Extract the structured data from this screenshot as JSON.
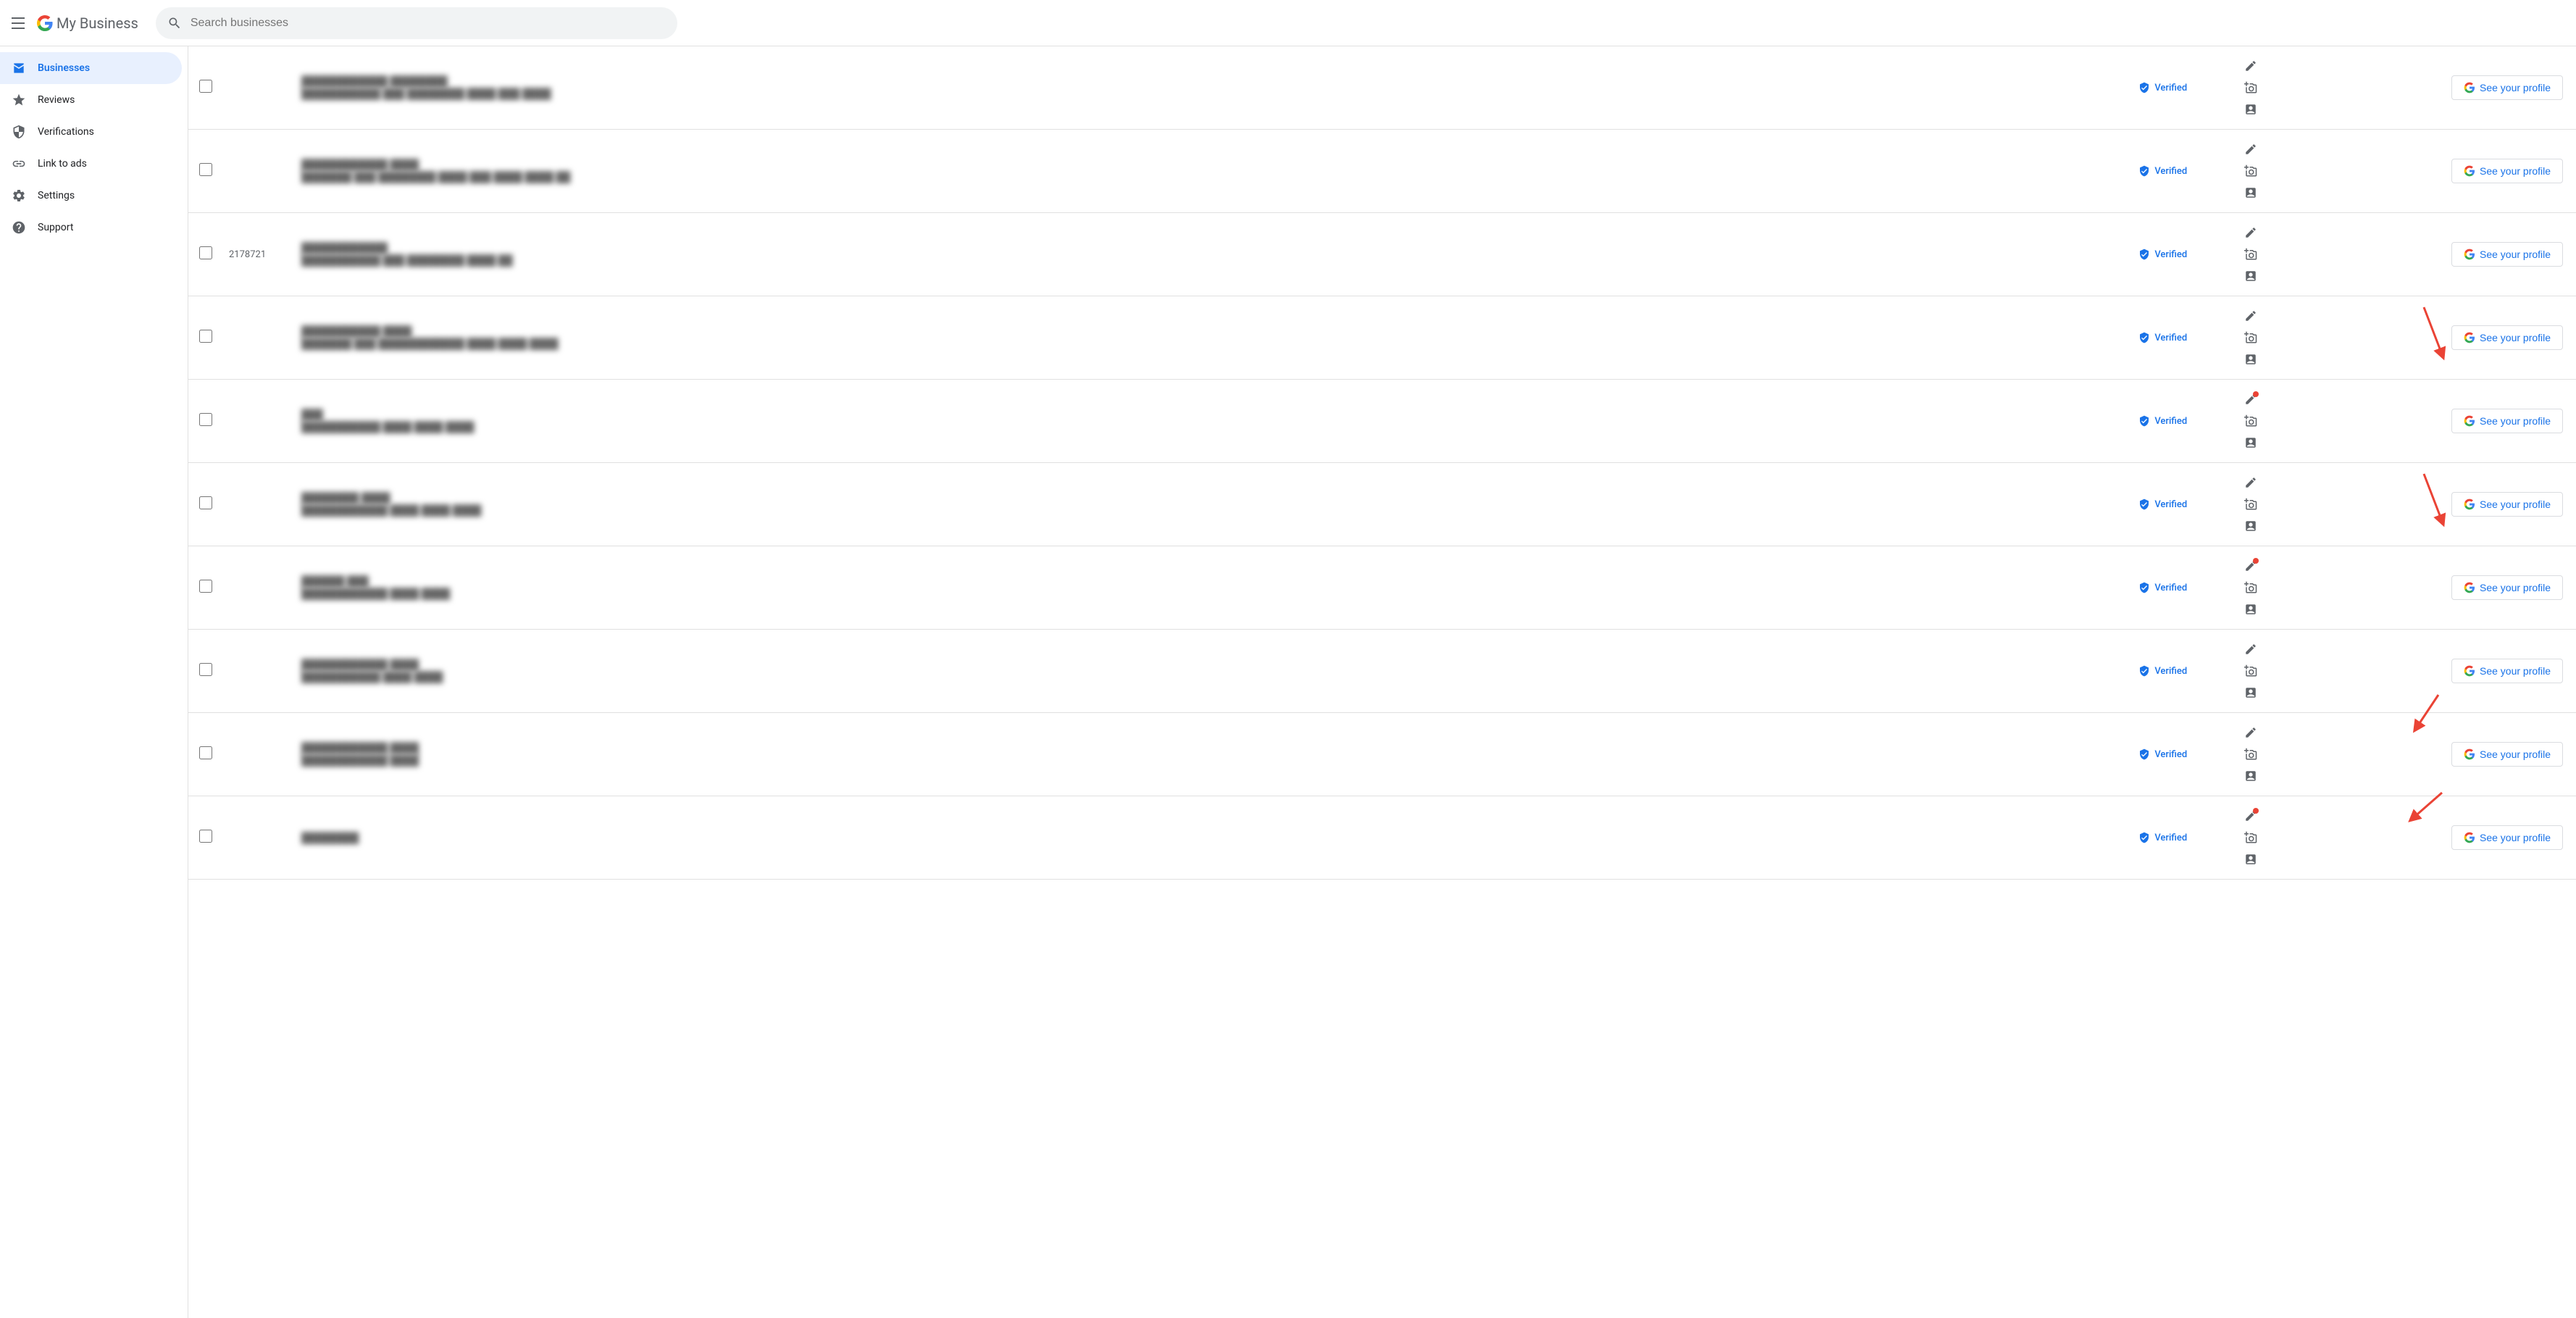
{
  "header": {
    "menu_label": "Main menu",
    "logo_google": "Google",
    "logo_my_business": " My Business",
    "search_placeholder": "Search businesses"
  },
  "sidebar": {
    "items": [
      {
        "id": "businesses",
        "label": "Businesses",
        "icon": "store",
        "active": true
      },
      {
        "id": "reviews",
        "label": "Reviews",
        "icon": "star",
        "active": false
      },
      {
        "id": "verifications",
        "label": "Verifications",
        "icon": "shield",
        "active": false
      },
      {
        "id": "link-to-ads",
        "label": "Link to ads",
        "icon": "link",
        "active": false
      },
      {
        "id": "settings",
        "label": "Settings",
        "icon": "settings",
        "active": false
      },
      {
        "id": "support",
        "label": "Support",
        "icon": "help",
        "active": false
      }
    ]
  },
  "table": {
    "rows": [
      {
        "id": "",
        "hasRedDot": false,
        "hasArrow": false,
        "verified": true
      },
      {
        "id": "",
        "hasRedDot": false,
        "hasArrow": false,
        "verified": true
      },
      {
        "id": "2178721",
        "hasRedDot": false,
        "hasArrow": false,
        "verified": true
      },
      {
        "id": "",
        "hasRedDot": false,
        "hasArrow": false,
        "verified": true
      },
      {
        "id": "",
        "hasRedDot": true,
        "hasArrow": true,
        "arrowDir": "left",
        "verified": true
      },
      {
        "id": "",
        "hasRedDot": false,
        "hasArrow": false,
        "verified": true
      },
      {
        "id": "",
        "hasRedDot": true,
        "hasArrow": true,
        "arrowDir": "left",
        "verified": true
      },
      {
        "id": "",
        "hasRedDot": false,
        "hasArrow": false,
        "verified": true
      },
      {
        "id": "",
        "hasRedDot": false,
        "hasArrow": true,
        "arrowDir": "down",
        "verified": true
      },
      {
        "id": "",
        "hasRedDot": true,
        "hasArrow": true,
        "arrowDir": "down",
        "verified": true
      }
    ],
    "verified_label": "Verified",
    "see_profile_label": "See your profile"
  }
}
